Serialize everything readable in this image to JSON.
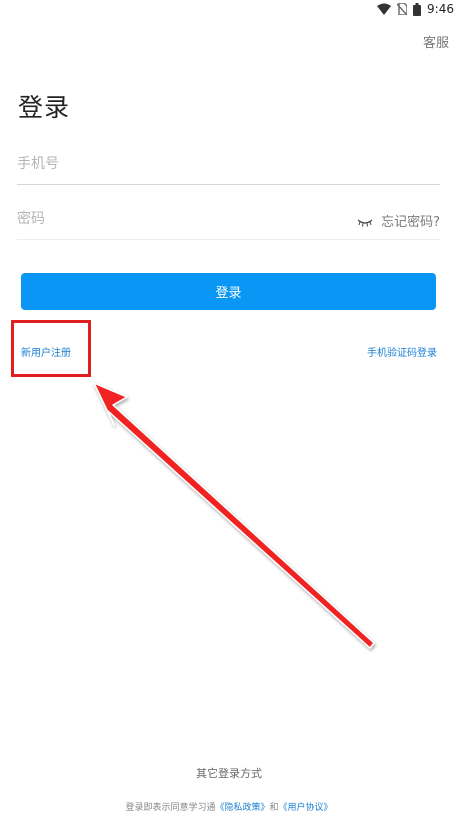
{
  "status_bar": {
    "time": "9:46",
    "icons": [
      "wifi-icon",
      "no-sim-icon",
      "battery-icon"
    ]
  },
  "header": {
    "service_label": "客服",
    "title": "登录"
  },
  "form": {
    "phone_placeholder": "手机号",
    "phone_value": "",
    "password_placeholder": "密码",
    "password_value": "",
    "forgot_label": "忘记密码?",
    "login_button": "登录"
  },
  "links": {
    "register": "新用户注册",
    "sms_login": "手机验证码登录"
  },
  "footer": {
    "other_login": "其它登录方式",
    "agreement_prefix": "登录即表示同意学习通",
    "privacy_link": "《隐私政策》",
    "agreement_and": "和",
    "user_agreement_link": "《用户协议》"
  },
  "colors": {
    "accent": "#0a96f5",
    "link": "#1a7fd3",
    "annotation": "#e02020"
  }
}
